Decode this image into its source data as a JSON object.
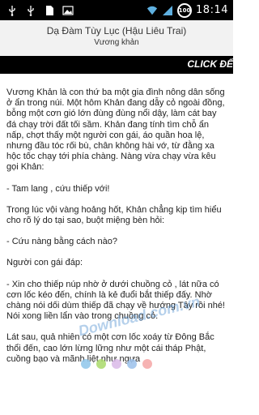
{
  "status_bar": {
    "time": "18:14",
    "battery_level": "100",
    "icons": [
      "usb-icon",
      "usb-debug-icon",
      "sd-card-icon",
      "image-icon",
      "wifi-icon",
      "signal-icon",
      "battery-icon"
    ]
  },
  "header": {
    "title": "Dạ Đàm Tùy Lục (Hậu Liêu Trai)",
    "subtitle": "Vương khản"
  },
  "banner": {
    "text": "CLICK ĐỂ"
  },
  "content": {
    "paragraphs": [
      "Vương Khản là con thứ ba một gia đình nông dân sống ở ẩn trong núi. Một hôm Khản đang dẫy cỏ ngoài đồng, bỗng một cơn gió lớn đùng đùng nổi dậy, làm cát bay đá chạy trời đất tối sầm. Khản đang tính tìm chỗ ẩn nấp, chợt thấy một người con gái, áo quần hoa lệ, nhưng đầu tóc rối bù, chân không hài vớ, từ đằng xa hộc tốc chạy tới phía chàng. Nàng vừa chạy vừa kêu gọi Khản:",
      "- Tam lang , cứu thiếp với!",
      "Trong lúc vội vàng hoảng hốt, Khản chẳng kịp tìm hiểu cho rõ lý do tại sao, buột miệng bèn hỏi:",
      "- Cứu nàng bằng cách nào?",
      "Người con gái đáp:",
      "- Xin cho thiếp núp nhờ ở dưới chuồng cỏ , lát nữa có cơn lốc kéo đến, chính là kẻ đuổi bắt thiếp đấy. Nhờ chàng nói dối dùm thiếp đã chạy về hướng Tây rồi nhé! Nói xong liền lẩn vào trong chuồng cỏ.",
      "Lát sau, quả nhiên có một cơn lốc xoáy từ Đông Bắc thổi đến, cao lớn lừng lững như một cái tháp Phật, cuồng bạo và mãnh liệt như ngựa"
    ]
  },
  "page_dots": {
    "colors": [
      "#8ec5ea",
      "#a9d96a",
      "#d9b8e8",
      "#9ac0ea",
      "#f4a6a6"
    ]
  },
  "watermark": {
    "text": "Download.com.vn"
  }
}
